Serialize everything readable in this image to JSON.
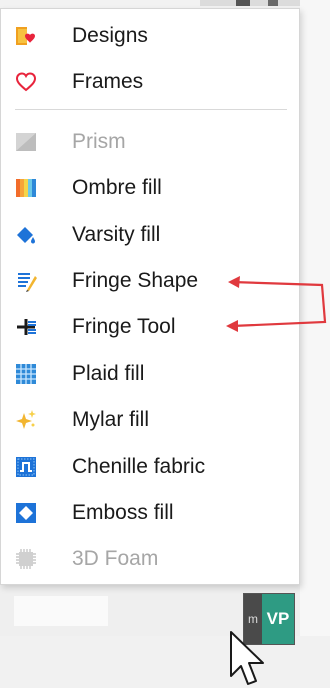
{
  "menu": {
    "items": [
      {
        "label": "Designs",
        "icon": "designs-icon",
        "enabled": true
      },
      {
        "label": "Frames",
        "icon": "heart-icon",
        "enabled": true
      },
      {
        "label": "Prism",
        "icon": "prism-icon",
        "enabled": false
      },
      {
        "label": "Ombre fill",
        "icon": "ombre-fill-icon",
        "enabled": true
      },
      {
        "label": "Varsity fill",
        "icon": "paint-bucket-icon",
        "enabled": true
      },
      {
        "label": "Fringe Shape",
        "icon": "fringe-shape-icon",
        "enabled": true
      },
      {
        "label": "Fringe Tool",
        "icon": "fringe-tool-icon",
        "enabled": true
      },
      {
        "label": "Plaid fill",
        "icon": "plaid-fill-icon",
        "enabled": true
      },
      {
        "label": "Mylar fill",
        "icon": "sparkle-icon",
        "enabled": true
      },
      {
        "label": "Chenille fabric",
        "icon": "chenille-icon",
        "enabled": true
      },
      {
        "label": "Emboss fill",
        "icon": "emboss-icon",
        "enabled": true
      },
      {
        "label": "3D Foam",
        "icon": "foam-icon",
        "enabled": false
      }
    ]
  },
  "app_badge": {
    "m": "m",
    "vp": "VP"
  },
  "colors": {
    "arrow": "#e0393e",
    "accent_blue": "#1e73d8",
    "vp_green": "#2e9b83"
  }
}
